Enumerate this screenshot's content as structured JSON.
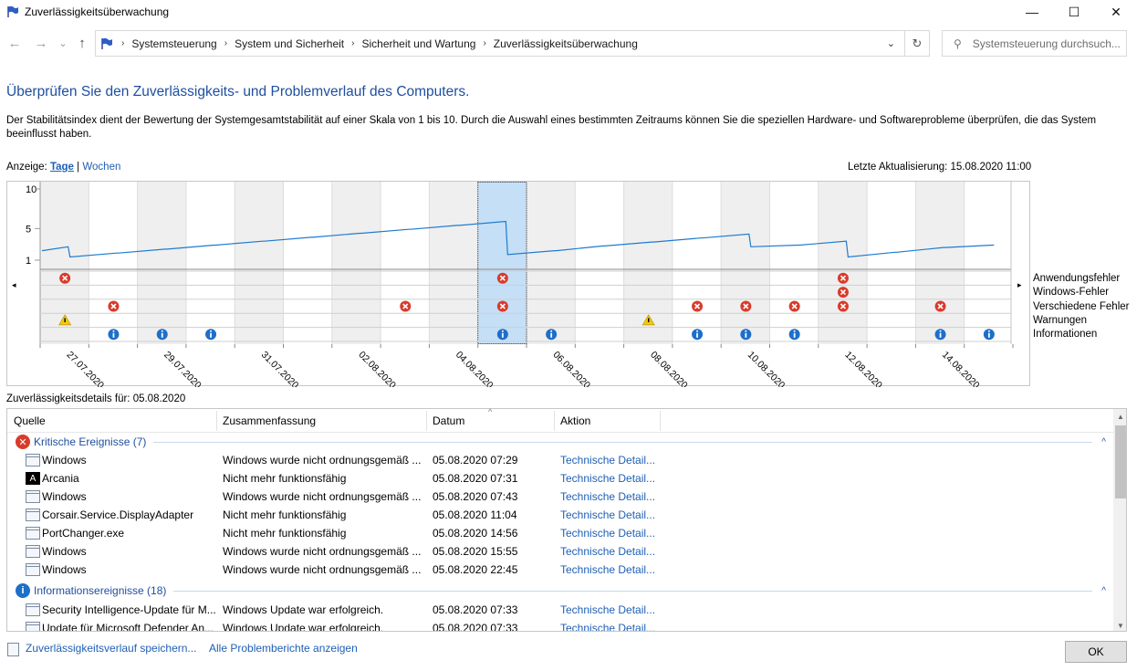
{
  "window": {
    "title": "Zuverlässigkeitsüberwachung",
    "minimize": "—",
    "maximize": "☐",
    "close": "✕"
  },
  "nav": {
    "back": "←",
    "forward": "→",
    "recent": "⌄",
    "up": "↑",
    "breadcrumbs": [
      "Systemsteuerung",
      "System und Sicherheit",
      "Sicherheit und Wartung",
      "Zuverlässigkeitsüberwachung"
    ],
    "refresh": "↻",
    "search_placeholder": "Systemsteuerung durchsuch..."
  },
  "heading": "Überprüfen Sie den Zuverlässigkeits- und Problemverlauf des Computers.",
  "description": "Der Stabilitätsindex dient der Bewertung der Systemgesamtstabilität auf einer Skala von 1 bis 10. Durch die Auswahl eines bestimmten Zeitraums können Sie die speziellen Hardware- und Softwareprobleme überprüfen, die das System beeinflusst haben.",
  "view": {
    "label": "Anzeige:",
    "days": "Tage",
    "sep": "|",
    "weeks": "Wochen"
  },
  "last_update": "Letzte Aktualisierung: 15.08.2020 11:00",
  "chart": {
    "y_ticks": [
      "10",
      "5",
      "1"
    ],
    "row_labels": [
      "Anwendungsfehler",
      "Windows-Fehler",
      "Verschiedene Fehler",
      "Warnungen",
      "Informationen"
    ],
    "date_labels": [
      "27.07.2020",
      "29.07.2020",
      "31.07.2020",
      "02.08.2020",
      "04.08.2020",
      "06.08.2020",
      "08.08.2020",
      "10.08.2020",
      "12.08.2020",
      "14.08.2020"
    ],
    "selected_column": 9,
    "columns": 20
  },
  "chart_data": {
    "type": "line",
    "x": [
      "26.07.",
      "27.07.",
      "28.07.",
      "29.07.",
      "30.07.",
      "31.07.",
      "01.08.",
      "02.08.",
      "03.08.",
      "04.08.",
      "05.08.",
      "06.08.",
      "07.08.",
      "08.08.",
      "09.08.",
      "10.08.",
      "11.08.",
      "12.08.",
      "13.08.",
      "14.08.",
      "15.08."
    ],
    "values": [
      2.2,
      1.4,
      1.9,
      2.4,
      2.9,
      3.4,
      3.9,
      4.4,
      4.9,
      5.4,
      1.7,
      2.2,
      2.8,
      3.3,
      3.8,
      2.7,
      2.9,
      1.4,
      2.0,
      2.6,
      2.9
    ],
    "ylim": [
      1,
      10
    ],
    "events": {
      "application_errors": [
        1,
        10,
        17
      ],
      "windows_errors": [
        17
      ],
      "misc_errors": [
        2,
        8,
        10,
        14,
        15,
        16,
        17,
        19
      ],
      "warnings": [
        1,
        13
      ],
      "information": [
        2,
        3,
        4,
        10,
        11,
        14,
        15,
        16,
        19,
        20
      ]
    }
  },
  "details": {
    "title": "Zuverlässigkeitsdetails für: 05.08.2020",
    "columns": [
      "Quelle",
      "Zusammenfassung",
      "Datum",
      "Aktion"
    ],
    "groups": [
      {
        "label": "Kritische Ereignisse (7)",
        "rows": [
          {
            "source": "Windows",
            "summary": "Windows wurde nicht ordnungsgemäß ...",
            "date": "05.08.2020 07:29",
            "action": "Technische Detail..."
          },
          {
            "source": "Arcania",
            "summary": "Nicht mehr funktionsfähig",
            "date": "05.08.2020 07:31",
            "action": "Technische Detail..."
          },
          {
            "source": "Windows",
            "summary": "Windows wurde nicht ordnungsgemäß ...",
            "date": "05.08.2020 07:43",
            "action": "Technische Detail..."
          },
          {
            "source": "Corsair.Service.DisplayAdapter",
            "summary": "Nicht mehr funktionsfähig",
            "date": "05.08.2020 11:04",
            "action": "Technische Detail..."
          },
          {
            "source": "PortChanger.exe",
            "summary": "Nicht mehr funktionsfähig",
            "date": "05.08.2020 14:56",
            "action": "Technische Detail..."
          },
          {
            "source": "Windows",
            "summary": "Windows wurde nicht ordnungsgemäß ...",
            "date": "05.08.2020 15:55",
            "action": "Technische Detail..."
          },
          {
            "source": "Windows",
            "summary": "Windows wurde nicht ordnungsgemäß ...",
            "date": "05.08.2020 22:45",
            "action": "Technische Detail..."
          }
        ]
      },
      {
        "label": "Informationsereignisse (18)",
        "rows": [
          {
            "source": "Security Intelligence-Update für M...",
            "summary": "Windows Update war erfolgreich.",
            "date": "05.08.2020 07:33",
            "action": "Technische Detail..."
          },
          {
            "source": "Update für Microsoft Defender An...",
            "summary": "Windows Update war erfolgreich.",
            "date": "05.08.2020 07:33",
            "action": "Technische Detail..."
          }
        ]
      }
    ]
  },
  "footer": {
    "save_link": "Zuverlässigkeitsverlauf speichern...",
    "all_reports_link": "Alle Problemberichte anzeigen",
    "ok": "OK"
  },
  "colors": {
    "link": "#1f5fb5",
    "heading": "#1f4fa0",
    "line": "#1e7bd0",
    "selection": "#c5dff7",
    "error": "#d83b2b",
    "info": "#1d6fc9",
    "warning": "#f2c811"
  }
}
